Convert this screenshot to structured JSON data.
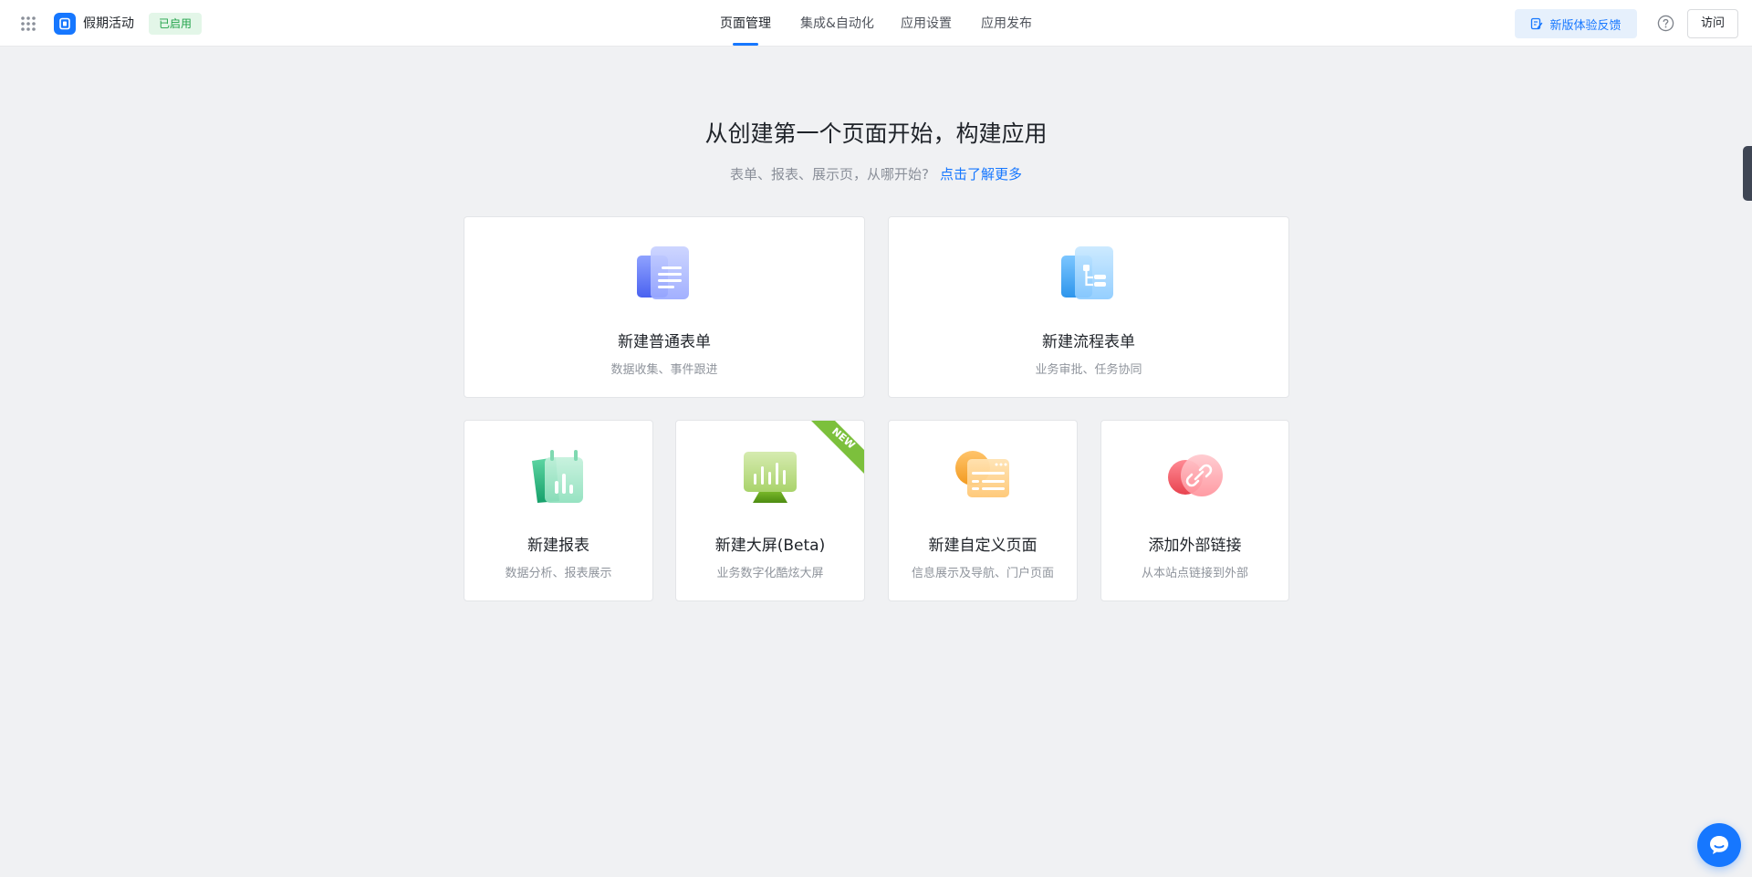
{
  "header": {
    "app_name": "假期活动",
    "status_badge": "已启用",
    "tabs": [
      {
        "label": "页面管理",
        "active": true
      },
      {
        "label": "集成&自动化",
        "active": false
      },
      {
        "label": "应用设置",
        "active": false
      },
      {
        "label": "应用发布",
        "active": false
      }
    ],
    "feedback_label": "新版体验反馈",
    "visit_label": "访问"
  },
  "hero": {
    "title": "从创建第一个页面开始，构建应用",
    "subtitle": "表单、报表、展示页，从哪开始?",
    "link_label": "点击了解更多"
  },
  "cards": [
    {
      "title": "新建普通表单",
      "desc": "数据收集、事件跟进",
      "icon": "form-document-icon"
    },
    {
      "title": "新建流程表单",
      "desc": "业务审批、任务协同",
      "icon": "process-form-icon"
    },
    {
      "title": "新建报表",
      "desc": "数据分析、报表展示",
      "icon": "report-chart-icon"
    },
    {
      "title": "新建大屏(Beta)",
      "desc": "业务数字化酷炫大屏",
      "icon": "dashboard-screen-icon",
      "badge": "NEW"
    },
    {
      "title": "新建自定义页面",
      "desc": "信息展示及导航、门户页面",
      "icon": "custom-page-icon"
    },
    {
      "title": "添加外部链接",
      "desc": "从本站点链接到外部",
      "icon": "external-link-icon"
    }
  ],
  "colors": {
    "accent": "#1677ff",
    "status_green": "#22a34a",
    "background": "#f0f1f3"
  }
}
